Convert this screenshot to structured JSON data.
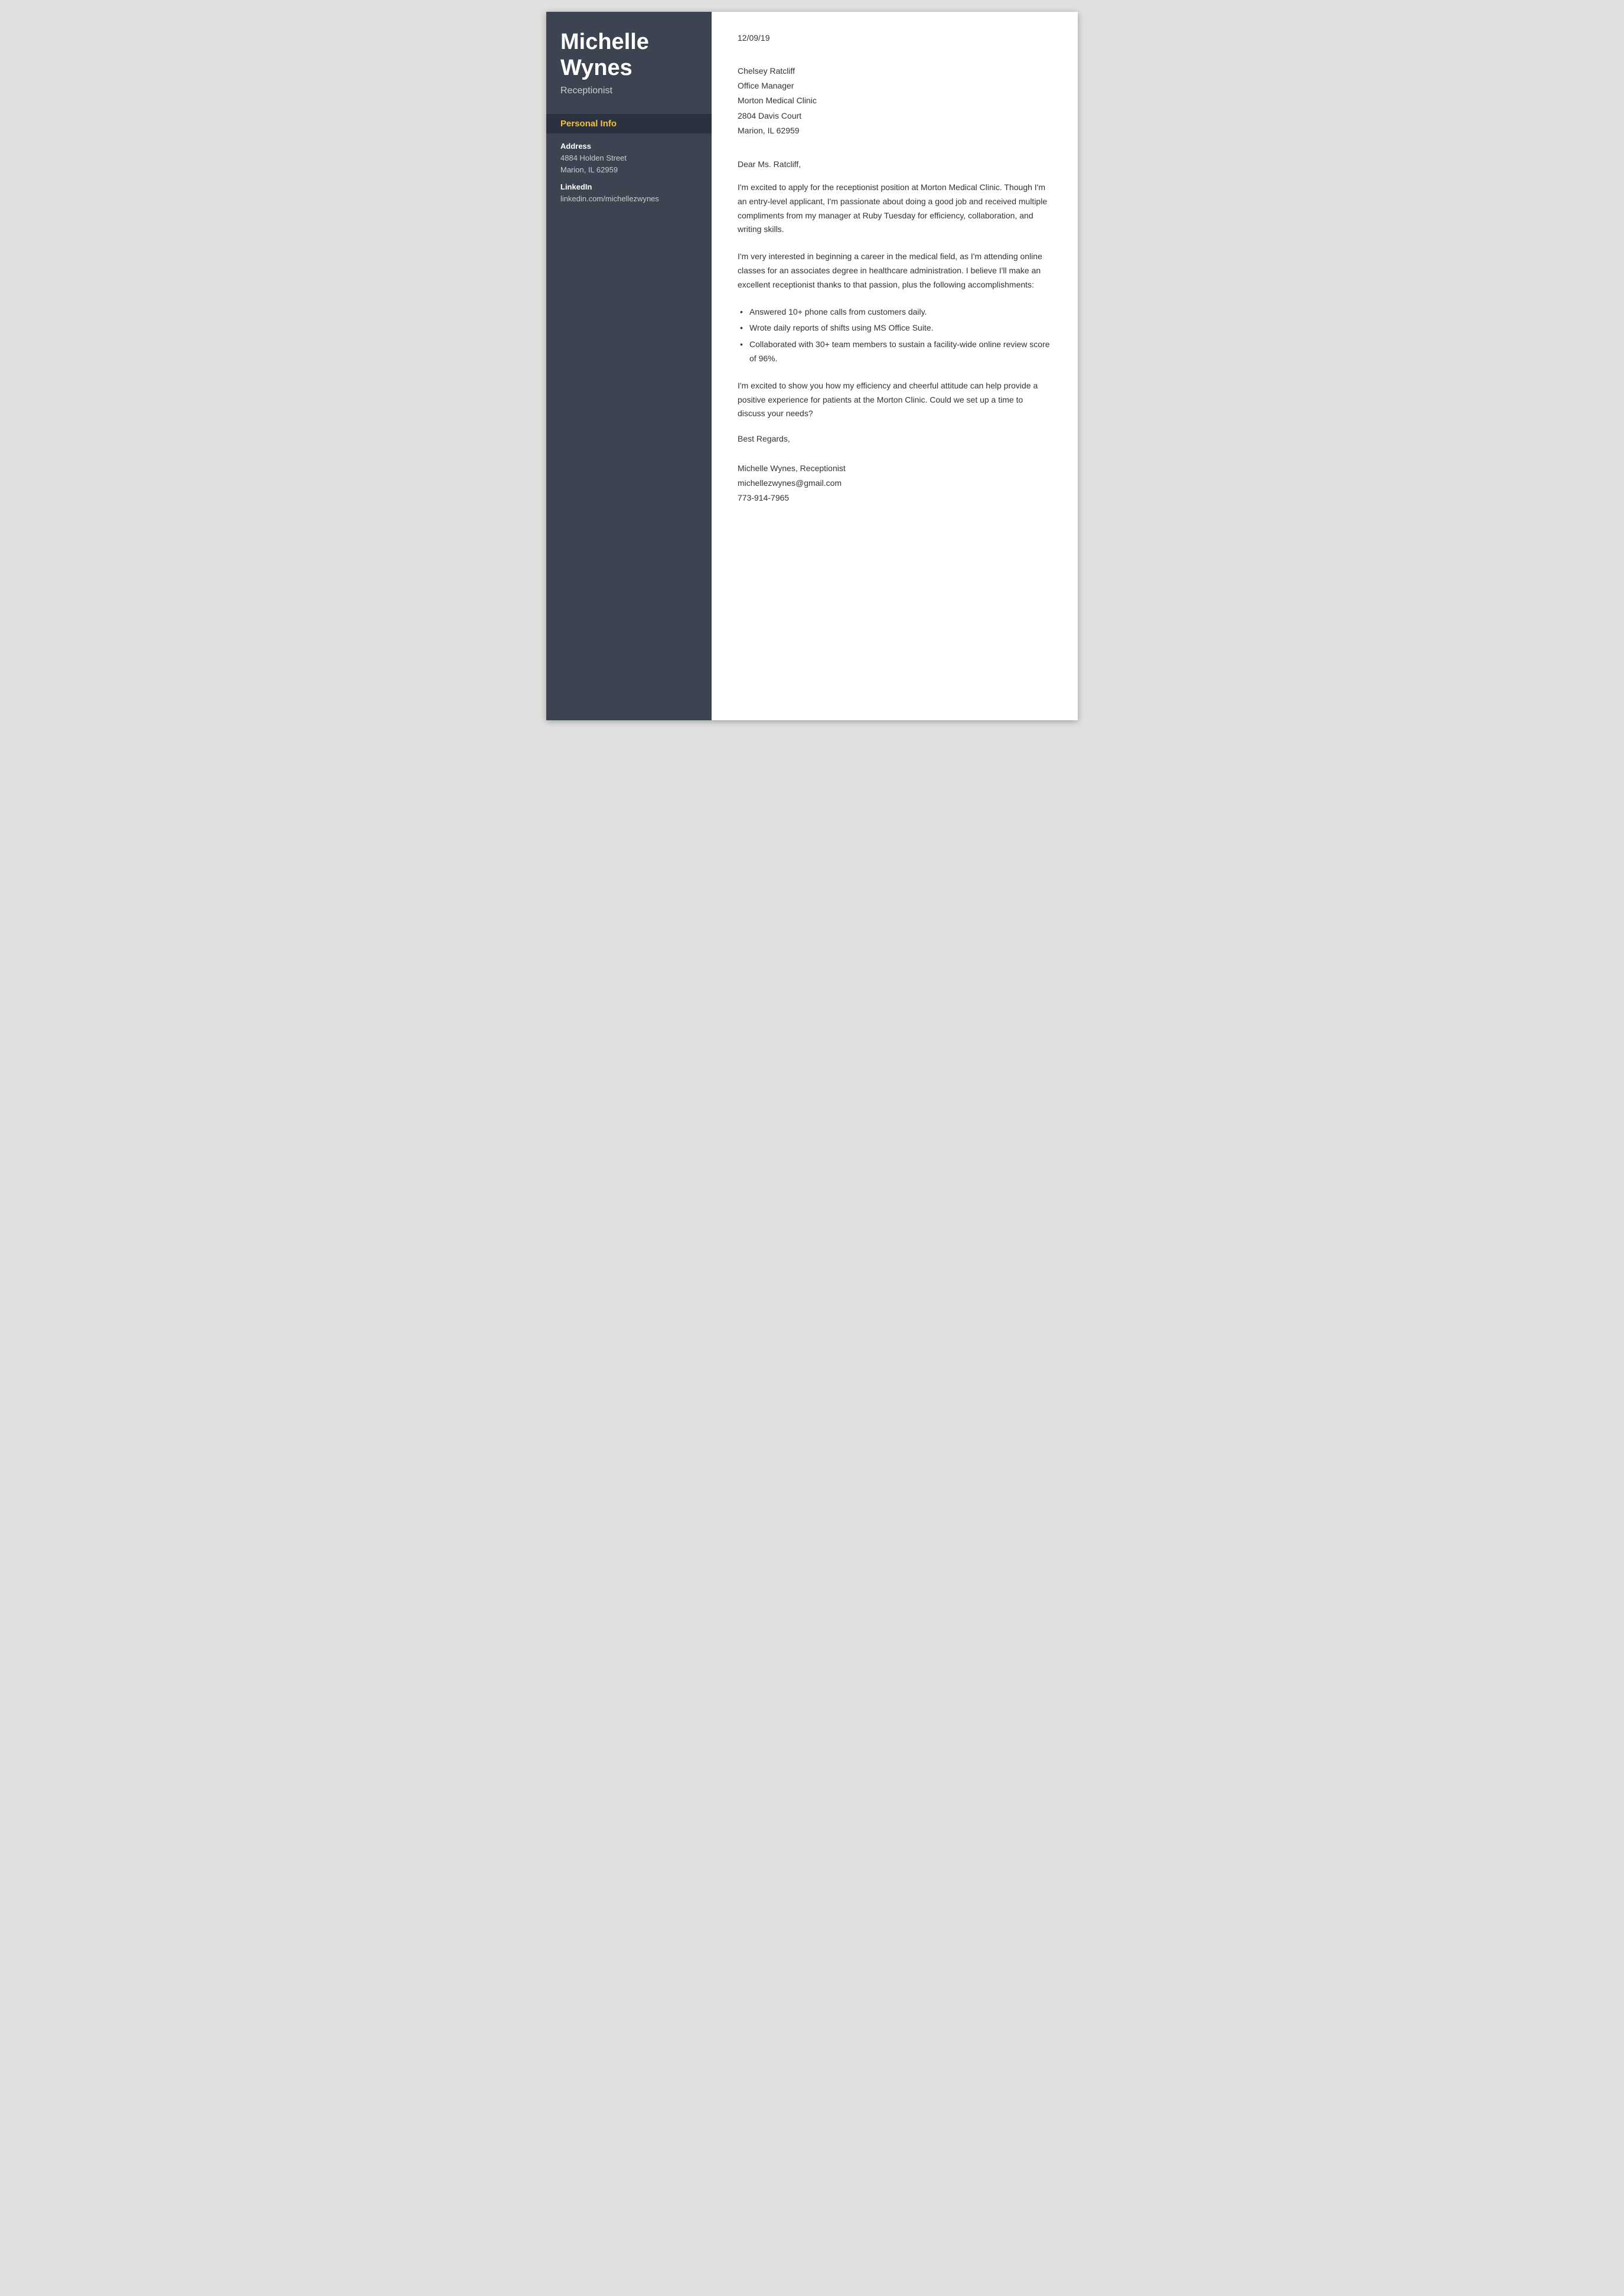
{
  "sidebar": {
    "name": "Michelle Wynes",
    "title": "Receptionist",
    "personal_info_heading": "Personal Info",
    "address_label": "Address",
    "address_line1": "4884 Holden Street",
    "address_line2": "Marion, IL 62959",
    "linkedin_label": "LinkedIn",
    "linkedin_value": "linkedin.com/michellezwynes"
  },
  "main": {
    "date": "12/09/19",
    "recipient": {
      "name": "Chelsey Ratcliff",
      "title": "Office Manager",
      "company": "Morton Medical Clinic",
      "address1": "2804 Davis Court",
      "address2": "Marion, IL 62959"
    },
    "salutation": "Dear Ms. Ratcliff,",
    "paragraphs": [
      "I'm excited to apply for the receptionist position at Morton Medical Clinic. Though I'm an entry-level applicant, I'm passionate about doing a good job and received multiple compliments from my manager at Ruby Tuesday for efficiency, collaboration, and writing skills.",
      "I'm very interested in beginning a career in the medical field, as I'm attending online classes for an associates degree in healthcare administration. I believe I'll make an excellent receptionist thanks to that passion, plus the following accomplishments:"
    ],
    "bullets": [
      "Answered 10+ phone calls from customers daily.",
      "Wrote daily reports of shifts using MS Office Suite.",
      "Collaborated with 30+ team members to sustain a facility-wide online review score of 96%."
    ],
    "closing_paragraph": "I'm excited to show you how my efficiency and cheerful attitude can help provide a positive experience for patients at the Morton Clinic. Could we set up a time to discuss your needs?",
    "valediction": "Best Regards,",
    "signature_name": "Michelle Wynes, Receptionist",
    "signature_email": "michellezwynes@gmail.com",
    "signature_phone": "773-914-7965"
  }
}
